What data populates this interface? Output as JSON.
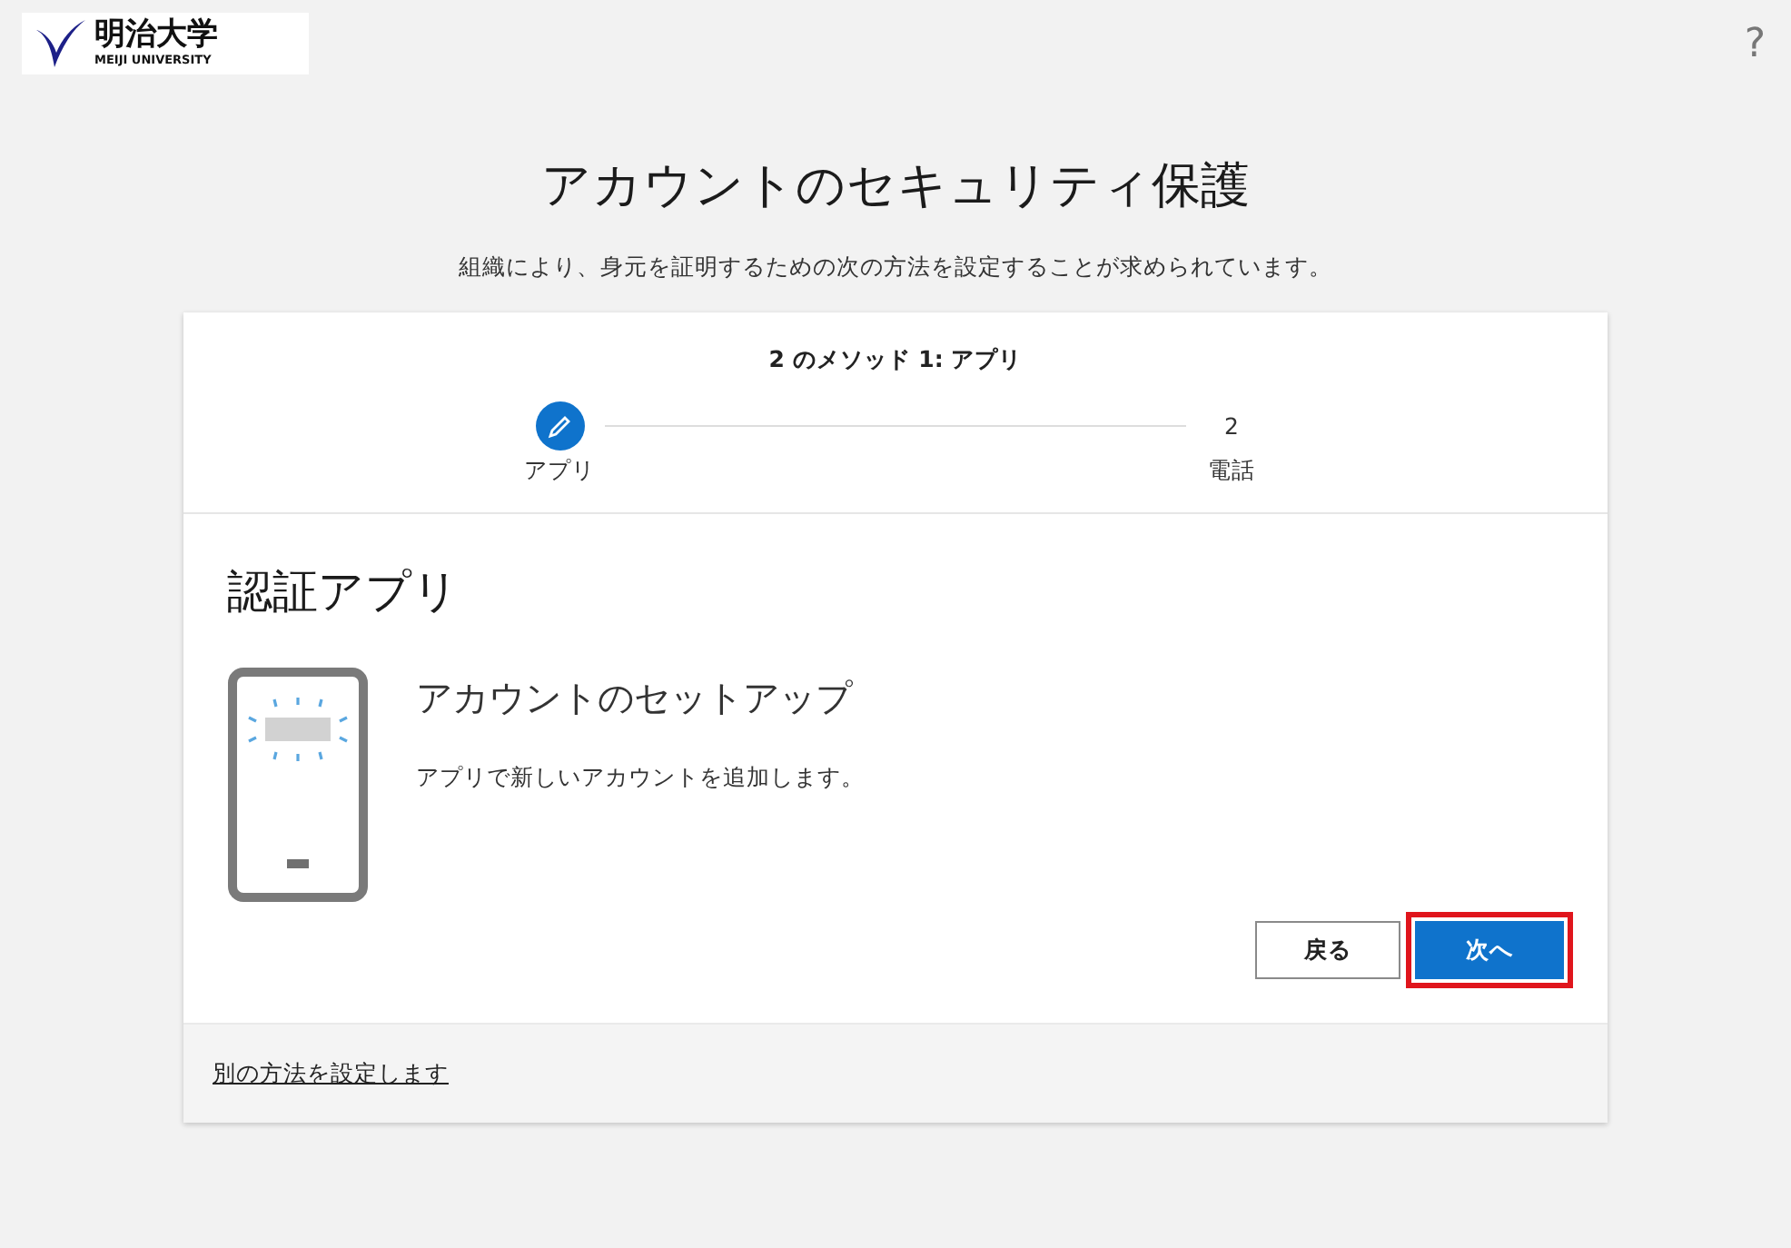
{
  "header": {
    "logo": {
      "name": "明治大学",
      "subtitle": "MEIJI UNIVERSITY"
    },
    "help": "?"
  },
  "title": "アカウントのセキュリティ保護",
  "subtitle": "組織により、身元を証明するための次の方法を設定することが求められています。",
  "card": {
    "progress": "2 のメソッド 1: アプリ",
    "steps": [
      {
        "label": "アプリ",
        "selected": true
      },
      {
        "number": "2",
        "label": "電話",
        "selected": false
      }
    ],
    "heading": "認証アプリ",
    "setup_title": "アカウントのセットアップ",
    "setup_text": "アプリで新しいアカウントを追加します。",
    "buttons": [
      {
        "label": "戻る",
        "kind": "secondary",
        "highlighted": false
      },
      {
        "label": "次へ",
        "kind": "primary",
        "highlighted": true
      }
    ],
    "footer_link": "別の方法を設定します"
  }
}
